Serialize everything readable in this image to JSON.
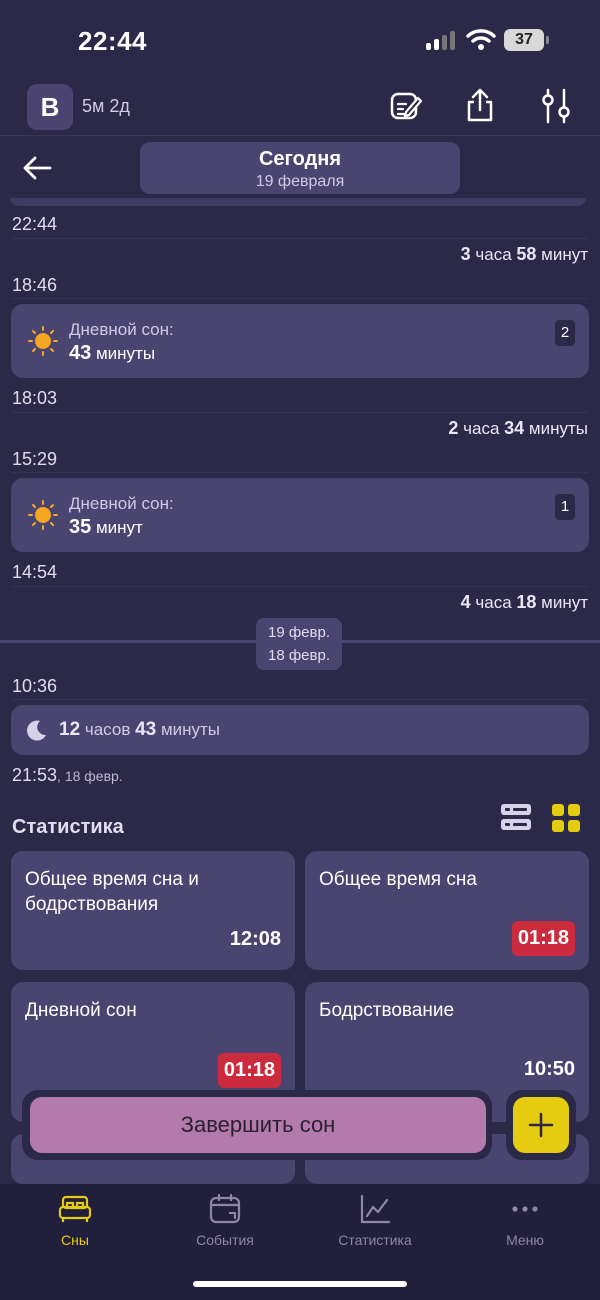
{
  "status_bar": {
    "time": "22:44",
    "battery": "37",
    "icons": [
      "signal-icon",
      "wifi-icon",
      "battery-icon"
    ]
  },
  "top_bar": {
    "avatar_letter": "B",
    "age": "5м 2д",
    "icons": [
      "edit-icon",
      "share-icon",
      "settings-sliders-icon"
    ]
  },
  "date_header": {
    "title": "Сегодня",
    "subtitle": "19 февраля",
    "back_icon": "arrow-left-icon"
  },
  "timeline": {
    "times": [
      "22:44",
      "18:46",
      "18:03",
      "15:29",
      "14:54",
      "10:36"
    ],
    "awake_1": {
      "num": "3",
      "unit1": " часа ",
      "num2": "58",
      "unit2": " минут"
    },
    "nap_2": {
      "label": "Дневной сон:",
      "value": "43",
      "unit": " минуты",
      "badge": "2"
    },
    "awake_2": {
      "num": "2",
      "unit1": " часа ",
      "num2": "34",
      "unit2": " минуты"
    },
    "nap_1": {
      "label": "Дневной сон:",
      "value": "35",
      "unit": " минут",
      "badge": "1"
    },
    "awake_3": {
      "num": "4",
      "unit1": " часа ",
      "num2": "18",
      "unit2": " минут"
    },
    "day_chip": {
      "current": "19 февр.",
      "previous": "18 февр."
    },
    "night": {
      "num": "12",
      "unit1": " часов ",
      "num2": "43",
      "unit2": " минуты"
    },
    "night_start": {
      "time": "21:53",
      "date": ", 18 февр."
    }
  },
  "stats": {
    "title": "Статистика",
    "view_icons": [
      "list-view-icon",
      "grid-view-icon"
    ],
    "cards": [
      {
        "label": "Общее время сна и бодрствования",
        "value": "12:08",
        "highlight": false
      },
      {
        "label": "Общее время сна",
        "value": "01:18",
        "highlight": true
      },
      {
        "label": "Дневной сон",
        "value": "01:18",
        "highlight": true
      },
      {
        "label": "Бодрствование",
        "value": "10:50",
        "highlight": false
      }
    ]
  },
  "actions": {
    "end_sleep": "Завершить сон",
    "add_icon": "plus-icon"
  },
  "bottom_nav": {
    "items": [
      {
        "label": "Сны",
        "icon": "bed-icon",
        "active": true
      },
      {
        "label": "События",
        "icon": "calendar-icon",
        "active": false
      },
      {
        "label": "Статистика",
        "icon": "chart-icon",
        "active": false
      },
      {
        "label": "Меню",
        "icon": "more-icon",
        "active": false
      }
    ]
  },
  "colors": {
    "background": "#2b2848",
    "card": "#4a4470",
    "accent_yellow": "#e5cc10",
    "alert_red": "#cc2b3e",
    "end_button": "#b27bab"
  }
}
